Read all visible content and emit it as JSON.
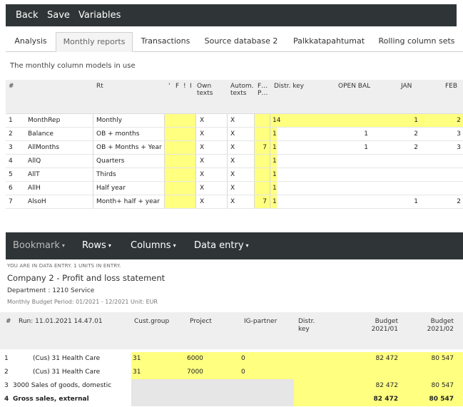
{
  "panel1": {
    "toolbar": {
      "back": "Back",
      "save": "Save",
      "variables": "Variables"
    },
    "tabs": [
      "Analysis",
      "Monthly reports",
      "Transactions",
      "Source database 2",
      "Palkkatapahtumat",
      "Rolling column sets"
    ],
    "active_tab": "Monthly reports",
    "subtitle": "The monthly column models in use",
    "columns": {
      "num": "#",
      "rt": "Rt",
      "v": "'",
      "f": "F",
      "s": "!",
      "i": "I",
      "own": "Own texts",
      "autom": "Autom. texts",
      "fp": "F… P…",
      "distr": "Distr. key",
      "openbal": "OPEN BAL",
      "jan": "JAN",
      "feb": "FEB"
    },
    "rows": [
      {
        "num": "1",
        "code": "MonthRep",
        "rt": "Monthly",
        "own": "X",
        "autom": "X",
        "fp": "",
        "distr": "14",
        "openbal": "",
        "jan": "1",
        "feb": "2"
      },
      {
        "num": "2",
        "code": "Balance",
        "rt": "OB + months",
        "own": "X",
        "autom": "X",
        "fp": "",
        "distr": "1",
        "openbal": "1",
        "jan": "2",
        "feb": "3"
      },
      {
        "num": "3",
        "code": "AllMonths",
        "rt": "OB + Months + Year",
        "own": "X",
        "autom": "X",
        "fp": "7",
        "distr": "1",
        "openbal": "1",
        "jan": "2",
        "feb": "3"
      },
      {
        "num": "4",
        "code": "AllQ",
        "rt": "Quarters",
        "own": "X",
        "autom": "X",
        "fp": "",
        "distr": "1",
        "openbal": "",
        "jan": "",
        "feb": ""
      },
      {
        "num": "5",
        "code": "AllT",
        "rt": "Thirds",
        "own": "X",
        "autom": "X",
        "fp": "",
        "distr": "1",
        "openbal": "",
        "jan": "",
        "feb": ""
      },
      {
        "num": "6",
        "code": "AllH",
        "rt": "Half year",
        "own": "X",
        "autom": "X",
        "fp": "",
        "distr": "1",
        "openbal": "",
        "jan": "",
        "feb": ""
      },
      {
        "num": "7",
        "code": "AlsoH",
        "rt": "Month+ half + year",
        "own": "X",
        "autom": "X",
        "fp": "7",
        "distr": "1",
        "openbal": "",
        "jan": "1",
        "feb": "2"
      }
    ]
  },
  "panel2": {
    "menu": {
      "bookmark": "Bookmark",
      "rows": "Rows",
      "columns": "Columns",
      "data_entry": "Data entry"
    },
    "caret": "▾",
    "info_mode": "YOU ARE IN DATA ENTRY. 1 UNITS IN ENTRY.",
    "report_title": "Company 2 - Profit and loss statement",
    "department": "Department : 1210 Service",
    "period": "Monthly Budget Period: 01/2021 - 12/2021 Unit: EUR",
    "columns": {
      "num": "#",
      "run": "Run: 11.01.2021 14.47.01",
      "custgroup": "Cust.group",
      "project": "Project",
      "igpartner": "IG-partner",
      "distr": "Distr. key",
      "budget1": "Budget 2021/01",
      "budget2": "Budget 2021/02"
    },
    "rows": [
      {
        "num": "1",
        "label": "(Cus) 31 Health Care",
        "custgroup": "31",
        "project": "6000",
        "igpartner": "0",
        "b1": "82 472",
        "b2": "80 547",
        "type": "entry"
      },
      {
        "num": "2",
        "label": "(Cus) 31 Health Care",
        "custgroup": "31",
        "project": "7000",
        "igpartner": "0",
        "b1": "",
        "b2": "",
        "type": "entry"
      },
      {
        "num": "3",
        "label": "3000 Sales of goods, domestic",
        "custgroup": "",
        "project": "",
        "igpartner": "",
        "b1": "82 472",
        "b2": "80 547",
        "type": "sum"
      },
      {
        "num": "4",
        "label": "Gross sales, external",
        "custgroup": "",
        "project": "",
        "igpartner": "",
        "b1": "82 472",
        "b2": "80 547",
        "type": "total"
      }
    ]
  }
}
